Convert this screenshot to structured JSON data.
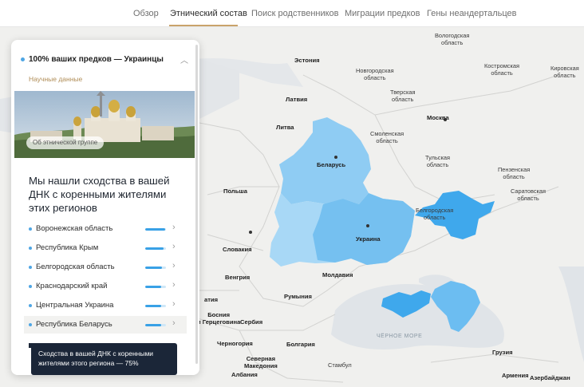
{
  "tabs": [
    {
      "label": "Обзор",
      "active": false
    },
    {
      "label": "Этнический состав",
      "active": true
    },
    {
      "label": "Поиск родственников",
      "active": false
    },
    {
      "label": "Миграции предков",
      "active": false
    },
    {
      "label": "Гены неандертальцев",
      "active": false
    }
  ],
  "panel": {
    "ancestry_title": "100% ваших предков — Украинцы",
    "science_link": "Научные данные",
    "photo_button": "Об этнической группе",
    "headline": "Мы нашли сходства в вашей ДНК с коренными жителями этих регионов",
    "regions": [
      {
        "name": "Воронежская область",
        "similarity": 0.95
      },
      {
        "name": "Республика Крым",
        "similarity": 0.9
      },
      {
        "name": "Белгородская область",
        "similarity": 0.8
      },
      {
        "name": "Краснодарский край",
        "similarity": 0.78
      },
      {
        "name": "Центральная Украина",
        "similarity": 0.78
      },
      {
        "name": "Республика Беларусь",
        "similarity": 0.75
      }
    ]
  },
  "tooltip": {
    "text": "Сходства в вашей ДНК с коренными жителями этого региона — 75%"
  },
  "map": {
    "labels": {
      "vologda": "Вологодская\nобласть",
      "kostroma": "Костромская\nобласть",
      "kirov": "Кировская\nобласть",
      "estonia": "Эстония",
      "novgorod": "Новгородская\nобласть",
      "tver": "Тверская\nобласть",
      "latvia": "Латвия",
      "moscow": "Москва",
      "lithuania": "Литва",
      "smolensk": "Смоленская\nобласть",
      "belarus": "Беларусь",
      "tula": "Тульская\nобласть",
      "penza": "Пензенская\nобласть",
      "poland": "Польша",
      "saratov": "Саратовская\nобласть",
      "belgorod": "Белгородская\nобласть",
      "ukraine": "Украина",
      "slovakia": "Словакия",
      "hungary": "Венгрия",
      "moldova": "Молдавия",
      "romania": "Румыния",
      "atia": "атия",
      "bosnia": "Босния\nи Герцеговина",
      "serbia": "Сербия",
      "black_sea": "ЧЁРНОЕ МОРЕ",
      "montenegro": "Черногория",
      "bulgaria": "Болгария",
      "georgia": "Грузия",
      "macedonia": "Северная\nМакедония",
      "istanbul": "Стамбул",
      "albania": "Албания",
      "armenia": "Армения",
      "azerbaijan": "Азербайджан"
    },
    "colors": {
      "land": "#f4f4f2",
      "water": "#dfe3e6",
      "belarus": "#8fccf3",
      "ukraine_west": "#a8d8f6",
      "ukraine_central": "#75c0f0",
      "voronezh": "#3fa8ec",
      "crimea": "#3fa8ec",
      "krasnodar": "#6cbdf1"
    }
  }
}
